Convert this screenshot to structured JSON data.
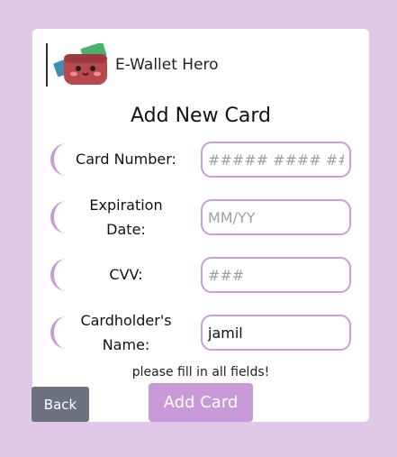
{
  "header": {
    "app_title": "E-Wallet Hero",
    "logo_icon": "wallet-mascot-icon"
  },
  "form": {
    "title": "Add New Card",
    "fields": [
      {
        "label": "Card Number:",
        "value": "",
        "placeholder": "##### #### ####"
      },
      {
        "label_line1": "Expiration",
        "label_line2": "Date:",
        "value": "",
        "placeholder": "MM/YY"
      },
      {
        "label": "CVV:",
        "value": "",
        "placeholder": "###"
      },
      {
        "label_line1": "Cardholder's",
        "label_line2": "Name:",
        "value": "jamil",
        "placeholder": ""
      }
    ],
    "hint": "please fill in all fields!"
  },
  "buttons": {
    "back_label": "Back",
    "add_label": "Add Card"
  },
  "colors": {
    "background": "#e1c8e9",
    "accent": "#c89ad8",
    "back_button": "#6c737e",
    "field_border": "#c8a0d8"
  }
}
